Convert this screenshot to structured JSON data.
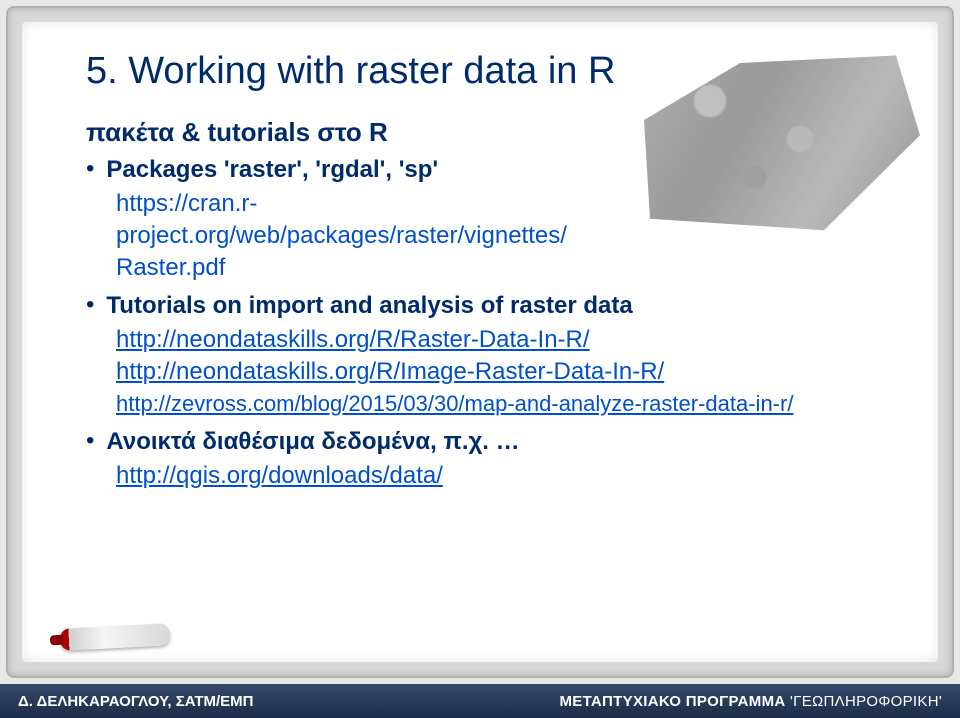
{
  "slide": {
    "title": "5. Working with raster data in R",
    "subtitle": "πακέτα & tutorials στο R",
    "bullets": [
      {
        "text": "Packages 'raster', 'rgdal', 'sp'",
        "bold": true
      },
      {
        "text": "Tutorials on import and analysis of raster data",
        "bold": true
      },
      {
        "text": "Ανοικτά διαθέσιμα δεδομένα, π.χ. …",
        "bold": true
      }
    ],
    "links": {
      "cran": "https://cran.r-project.org/web/packages/raster/vignettes/Raster.pdf",
      "cran_line1": "https://cran.r-",
      "cran_line2": "project.org/web/packages/raster/vignettes/",
      "cran_line3": "Raster.pdf",
      "neon1": "http://neondataskills.org/R/Raster-Data-In-R/",
      "neon2": "http://neondataskills.org/R/Image-Raster-Data-In-R/",
      "zevross": "http://zevross.com/blog/2015/03/30/map-and-analyze-raster-data-in-r/",
      "qgis": "http://qgis.org/downloads/data/"
    }
  },
  "footer": {
    "left": "Δ. ΔΕΛΗΚΑΡΑΟΓΛΟΥ, ΣΑΤΜ/ΕΜΠ",
    "right_prefix": "ΜΕΤΑΠΤΥΧΙΑΚΟ ΠΡΟΓΡΑΜΜΑ ",
    "right_quoted": "'ΓΕΩΠΛΗΡΟΦΟΡΙΚΗ'"
  }
}
